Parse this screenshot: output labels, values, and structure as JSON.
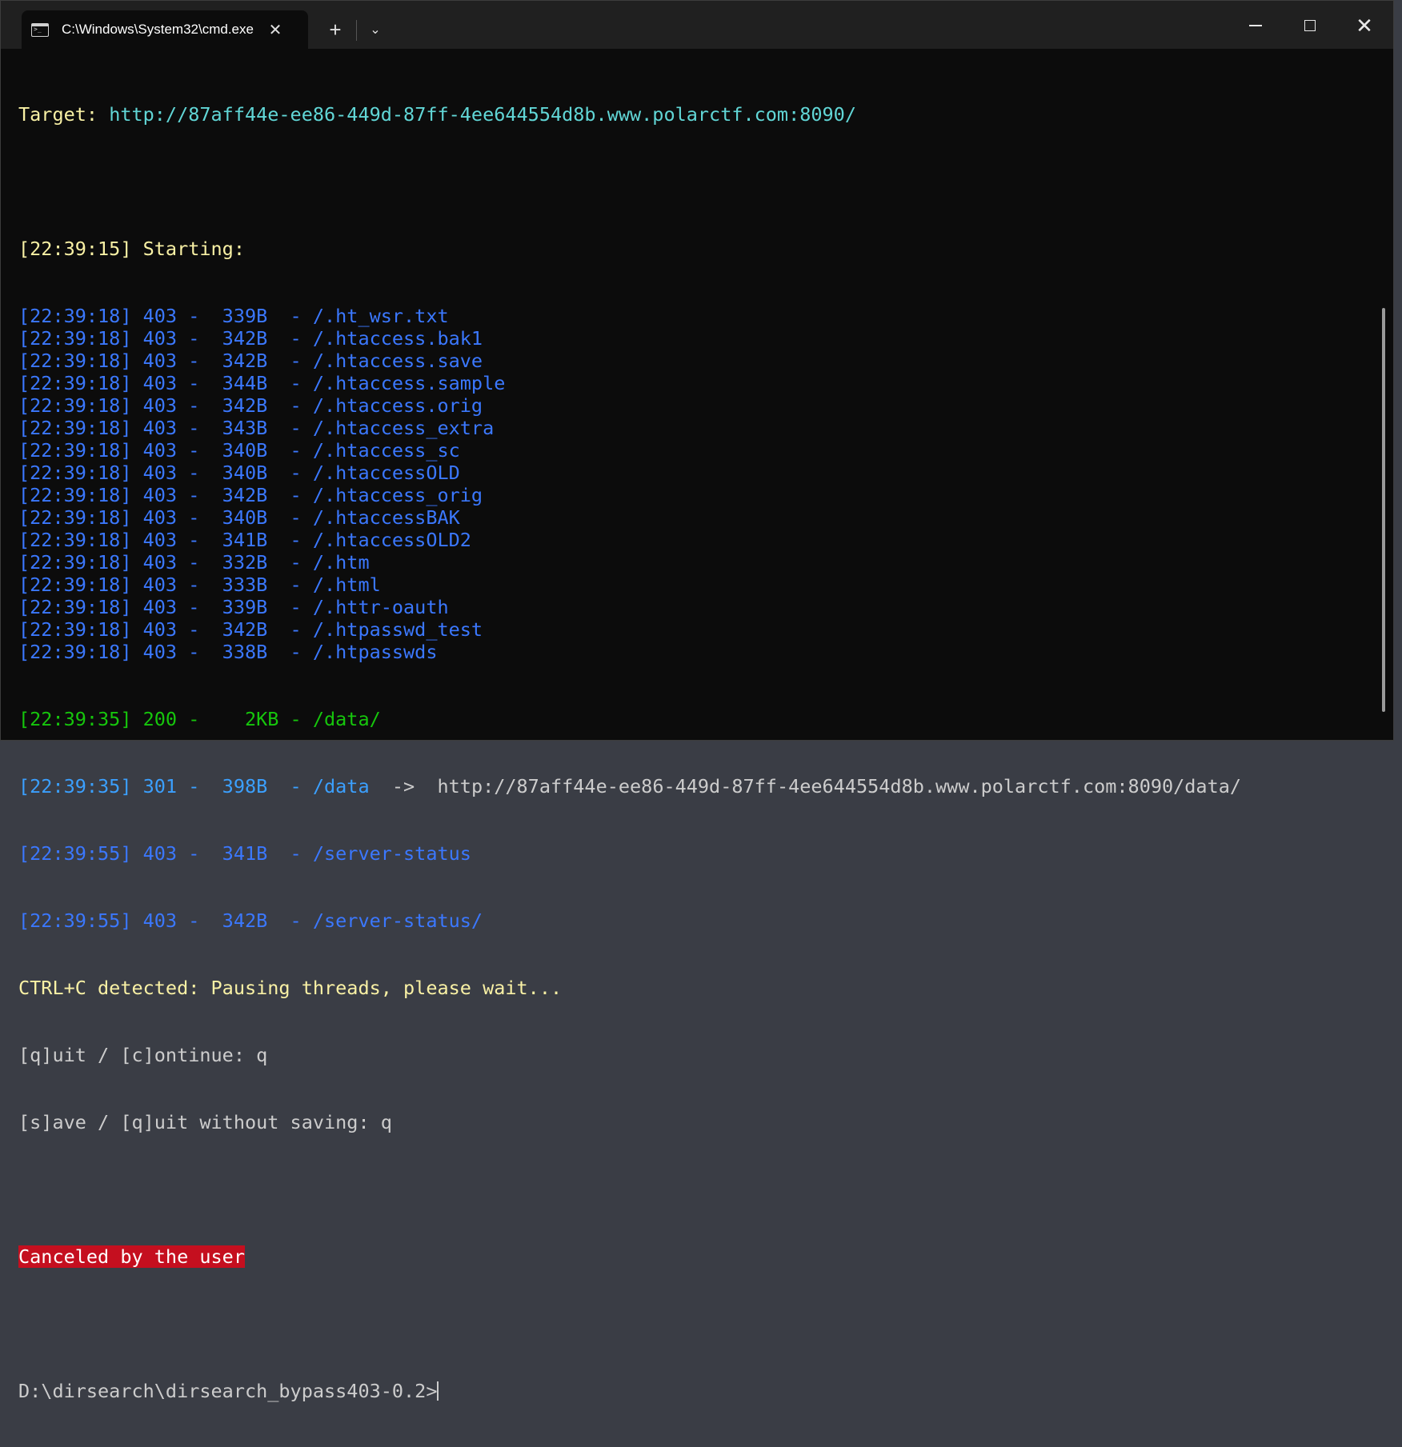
{
  "window": {
    "tab_title": "C:\\Windows\\System32\\cmd.exe",
    "tab_close": "✕",
    "new_tab": "+",
    "dropdown": "⌄",
    "close": "✕",
    "icons": {
      "minimize": "minimize-icon",
      "maximize": "maximize-icon",
      "close": "close-icon",
      "terminal": "terminal-icon"
    }
  },
  "terminal": {
    "target_label": "Target: ",
    "target_url": "http://87aff44e-ee86-449d-87ff-4ee644554d8b.www.polarctf.com:8090/",
    "starting": "[22:39:15] Starting:",
    "results": [
      "[22:39:18] 403 -  339B  - /.ht_wsr.txt",
      "[22:39:18] 403 -  342B  - /.htaccess.bak1",
      "[22:39:18] 403 -  342B  - /.htaccess.save",
      "[22:39:18] 403 -  344B  - /.htaccess.sample",
      "[22:39:18] 403 -  342B  - /.htaccess.orig",
      "[22:39:18] 403 -  343B  - /.htaccess_extra",
      "[22:39:18] 403 -  340B  - /.htaccess_sc",
      "[22:39:18] 403 -  340B  - /.htaccessOLD",
      "[22:39:18] 403 -  342B  - /.htaccess_orig",
      "[22:39:18] 403 -  340B  - /.htaccessBAK",
      "[22:39:18] 403 -  341B  - /.htaccessOLD2",
      "[22:39:18] 403 -  332B  - /.htm",
      "[22:39:18] 403 -  333B  - /.html",
      "[22:39:18] 403 -  339B  - /.httr-oauth",
      "[22:39:18] 403 -  342B  - /.htpasswd_test",
      "[22:39:18] 403 -  338B  - /.htpasswds"
    ],
    "ok_line": "[22:39:35] 200 -    2KB - /data/",
    "redirect_line": "[22:39:35] 301 -  398B  - /data",
    "redirect_arrow": "  ->  ",
    "redirect_target": "http://87aff44e-ee86-449d-87ff-4ee644554d8b.www.polarctf.com:8090/data/",
    "status_lines": [
      "[22:39:55] 403 -  341B  - /server-status",
      "[22:39:55] 403 -  342B  - /server-status/"
    ],
    "ctrlc": "CTRL+C detected: Pausing threads, please wait...",
    "quit_prompt": "[q]uit / [c]ontinue: q",
    "save_prompt": "[s]ave / [q]uit without saving: q",
    "canceled": "Canceled by the user",
    "prompt": "D:\\dirsearch\\dirsearch_bypass403-0.2>"
  }
}
